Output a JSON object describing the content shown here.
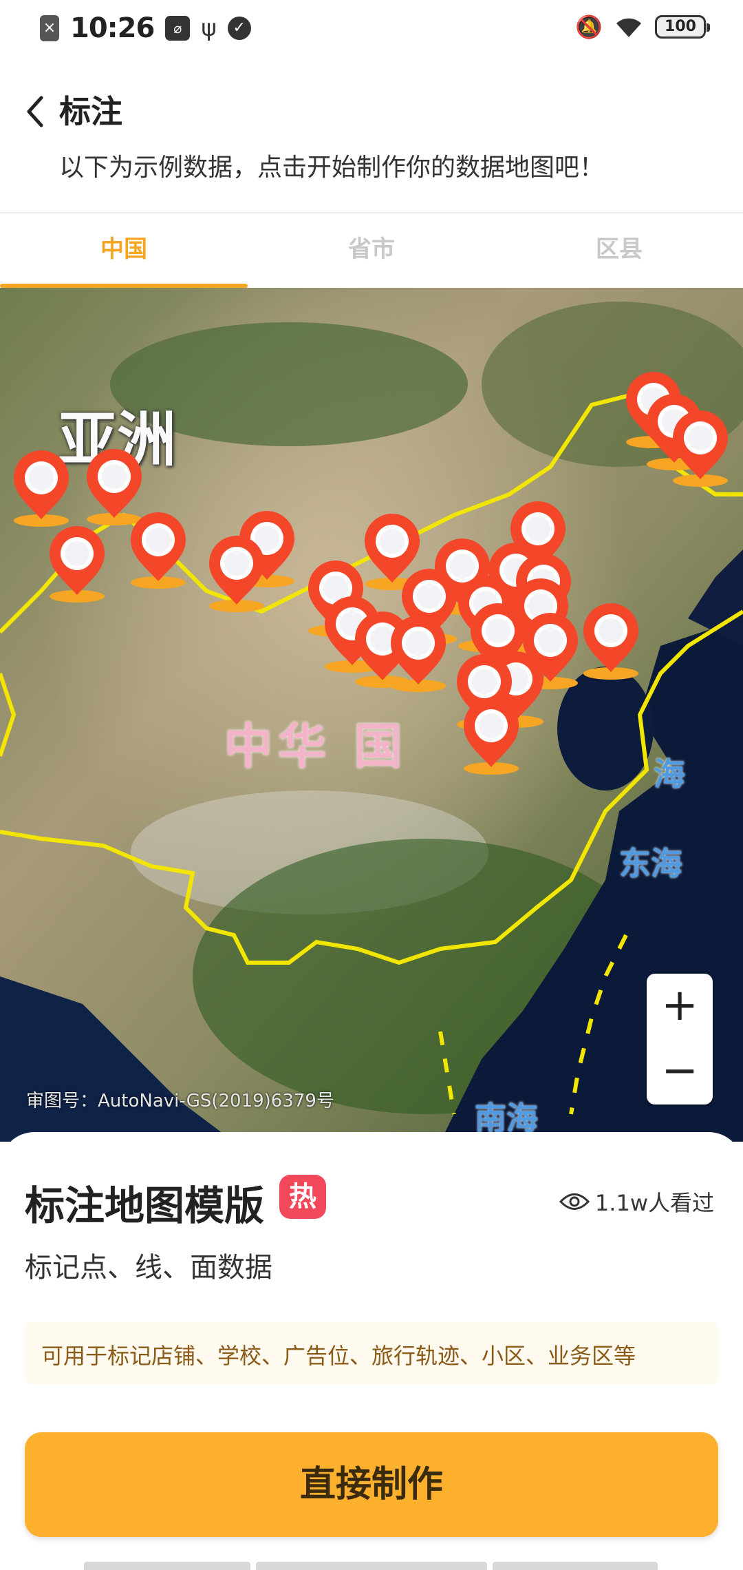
{
  "status_bar": {
    "time": "10:26",
    "battery": "100",
    "icons": [
      "close-box-icon",
      "app-box-icon",
      "usb-icon",
      "check-circle-icon",
      "bell-off-icon",
      "wifi-icon",
      "battery-icon"
    ]
  },
  "header": {
    "title": "标注",
    "subtitle": "以下为示例数据，点击开始制作你的数据地图吧！"
  },
  "tabs": [
    {
      "label": "中国",
      "active": true
    },
    {
      "label": "省市",
      "active": false
    },
    {
      "label": "区县",
      "active": false
    }
  ],
  "map": {
    "labels": {
      "asia": "亚洲",
      "china": "中华 国",
      "east_sea": "东海",
      "yellow_sea": "海",
      "south_sea": "南海"
    },
    "credit": "审图号：AutoNavi-GS(2019)6379号",
    "zoom_in": "+",
    "zoom_out": "−",
    "pin_icon": "map-pin-icon",
    "colors": {
      "pin": "#f4472a",
      "border": "#f2e600",
      "accent": "#f6a623"
    }
  },
  "card": {
    "title": "标注地图模版",
    "hot_badge": "热",
    "views": "1.1w人看过",
    "description": "标记点、线、面数据",
    "usage": "可用于标记店铺、学校、广告位、旅行轨迹、小区、业务区等",
    "button": "直接制作"
  }
}
